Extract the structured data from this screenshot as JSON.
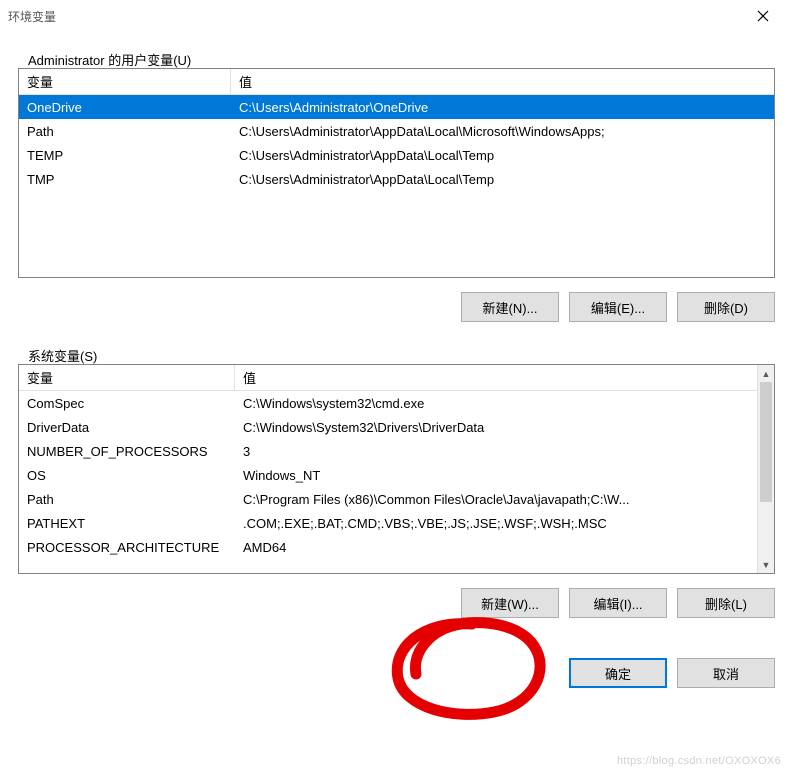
{
  "window": {
    "title": "环境变量"
  },
  "userVars": {
    "groupLabel": "Administrator 的用户变量(U)",
    "headers": {
      "variable": "变量",
      "value": "值"
    },
    "rows": [
      {
        "variable": "OneDrive",
        "value": "C:\\Users\\Administrator\\OneDrive",
        "selected": true
      },
      {
        "variable": "Path",
        "value": "C:\\Users\\Administrator\\AppData\\Local\\Microsoft\\WindowsApps;",
        "selected": false
      },
      {
        "variable": "TEMP",
        "value": "C:\\Users\\Administrator\\AppData\\Local\\Temp",
        "selected": false
      },
      {
        "variable": "TMP",
        "value": "C:\\Users\\Administrator\\AppData\\Local\\Temp",
        "selected": false
      }
    ],
    "buttons": {
      "new": "新建(N)...",
      "edit": "编辑(E)...",
      "delete": "删除(D)"
    }
  },
  "systemVars": {
    "groupLabel": "系统变量(S)",
    "headers": {
      "variable": "变量",
      "value": "值"
    },
    "rows": [
      {
        "variable": "ComSpec",
        "value": "C:\\Windows\\system32\\cmd.exe"
      },
      {
        "variable": "DriverData",
        "value": "C:\\Windows\\System32\\Drivers\\DriverData"
      },
      {
        "variable": "NUMBER_OF_PROCESSORS",
        "value": "3"
      },
      {
        "variable": "OS",
        "value": "Windows_NT"
      },
      {
        "variable": "Path",
        "value": "C:\\Program Files (x86)\\Common Files\\Oracle\\Java\\javapath;C:\\W..."
      },
      {
        "variable": "PATHEXT",
        "value": ".COM;.EXE;.BAT;.CMD;.VBS;.VBE;.JS;.JSE;.WSF;.WSH;.MSC"
      },
      {
        "variable": "PROCESSOR_ARCHITECTURE",
        "value": "AMD64"
      }
    ],
    "buttons": {
      "new": "新建(W)...",
      "edit": "编辑(I)...",
      "delete": "删除(L)"
    }
  },
  "footer": {
    "ok": "确定",
    "cancel": "取消"
  },
  "watermark": "https://blog.csdn.net/OXOXOX6"
}
